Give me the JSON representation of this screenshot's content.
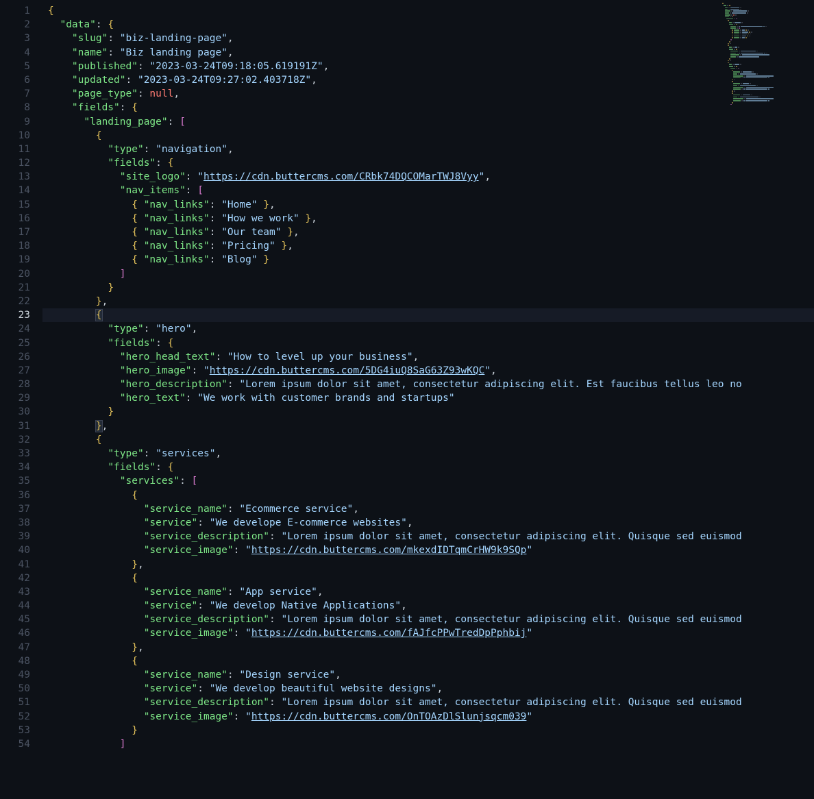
{
  "currentLine": 23,
  "colors": {
    "key": "#7ee787",
    "string": "#a5d6ff",
    "brace": "#e2c15a",
    "bracket": "#d97bd0",
    "null": "#ff7b72",
    "text": "#c9d1d9",
    "bg": "#0d1117"
  },
  "lines": [
    {
      "n": 1,
      "indent": 0,
      "tokens": [
        [
          "brace",
          "{"
        ]
      ]
    },
    {
      "n": 2,
      "indent": 1,
      "tokens": [
        [
          "key",
          "\"data\""
        ],
        [
          "punc",
          ": "
        ],
        [
          "brace",
          "{"
        ]
      ]
    },
    {
      "n": 3,
      "indent": 2,
      "tokens": [
        [
          "key",
          "\"slug\""
        ],
        [
          "punc",
          ": "
        ],
        [
          "str",
          "\"biz-landing-page\""
        ],
        [
          "punc",
          ","
        ]
      ]
    },
    {
      "n": 4,
      "indent": 2,
      "tokens": [
        [
          "key",
          "\"name\""
        ],
        [
          "punc",
          ": "
        ],
        [
          "str",
          "\"Biz landing page\""
        ],
        [
          "punc",
          ","
        ]
      ]
    },
    {
      "n": 5,
      "indent": 2,
      "tokens": [
        [
          "key",
          "\"published\""
        ],
        [
          "punc",
          ": "
        ],
        [
          "str",
          "\"2023-03-24T09:18:05.619191Z\""
        ],
        [
          "punc",
          ","
        ]
      ]
    },
    {
      "n": 6,
      "indent": 2,
      "tokens": [
        [
          "key",
          "\"updated\""
        ],
        [
          "punc",
          ": "
        ],
        [
          "str",
          "\"2023-03-24T09:27:02.403718Z\""
        ],
        [
          "punc",
          ","
        ]
      ]
    },
    {
      "n": 7,
      "indent": 2,
      "tokens": [
        [
          "key",
          "\"page_type\""
        ],
        [
          "punc",
          ": "
        ],
        [
          "null",
          "null"
        ],
        [
          "punc",
          ","
        ]
      ]
    },
    {
      "n": 8,
      "indent": 2,
      "tokens": [
        [
          "key",
          "\"fields\""
        ],
        [
          "punc",
          ": "
        ],
        [
          "brace",
          "{"
        ]
      ]
    },
    {
      "n": 9,
      "indent": 3,
      "tokens": [
        [
          "key",
          "\"landing_page\""
        ],
        [
          "punc",
          ": "
        ],
        [
          "bracket",
          "["
        ]
      ]
    },
    {
      "n": 10,
      "indent": 4,
      "tokens": [
        [
          "brace",
          "{"
        ]
      ]
    },
    {
      "n": 11,
      "indent": 5,
      "tokens": [
        [
          "key",
          "\"type\""
        ],
        [
          "punc",
          ": "
        ],
        [
          "str",
          "\"navigation\""
        ],
        [
          "punc",
          ","
        ]
      ]
    },
    {
      "n": 12,
      "indent": 5,
      "tokens": [
        [
          "key",
          "\"fields\""
        ],
        [
          "punc",
          ": "
        ],
        [
          "brace",
          "{"
        ]
      ]
    },
    {
      "n": 13,
      "indent": 6,
      "tokens": [
        [
          "key",
          "\"site_logo\""
        ],
        [
          "punc",
          ": "
        ],
        [
          "str",
          "\""
        ],
        [
          "link",
          "https://cdn.buttercms.com/CRbk74DQCOMarTWJ8Vyy"
        ],
        [
          "str",
          "\""
        ],
        [
          "punc",
          ","
        ]
      ]
    },
    {
      "n": 14,
      "indent": 6,
      "tokens": [
        [
          "key",
          "\"nav_items\""
        ],
        [
          "punc",
          ": "
        ],
        [
          "bracket",
          "["
        ]
      ]
    },
    {
      "n": 15,
      "indent": 7,
      "tokens": [
        [
          "brace",
          "{ "
        ],
        [
          "key",
          "\"nav_links\""
        ],
        [
          "punc",
          ": "
        ],
        [
          "str",
          "\"Home\""
        ],
        [
          "brace",
          " }"
        ],
        [
          "punc",
          ","
        ]
      ]
    },
    {
      "n": 16,
      "indent": 7,
      "tokens": [
        [
          "brace",
          "{ "
        ],
        [
          "key",
          "\"nav_links\""
        ],
        [
          "punc",
          ": "
        ],
        [
          "str",
          "\"How we work\""
        ],
        [
          "brace",
          " }"
        ],
        [
          "punc",
          ","
        ]
      ]
    },
    {
      "n": 17,
      "indent": 7,
      "tokens": [
        [
          "brace",
          "{ "
        ],
        [
          "key",
          "\"nav_links\""
        ],
        [
          "punc",
          ": "
        ],
        [
          "str",
          "\"Our team\""
        ],
        [
          "brace",
          " }"
        ],
        [
          "punc",
          ","
        ]
      ]
    },
    {
      "n": 18,
      "indent": 7,
      "tokens": [
        [
          "brace",
          "{ "
        ],
        [
          "key",
          "\"nav_links\""
        ],
        [
          "punc",
          ": "
        ],
        [
          "str",
          "\"Pricing\""
        ],
        [
          "brace",
          " }"
        ],
        [
          "punc",
          ","
        ]
      ]
    },
    {
      "n": 19,
      "indent": 7,
      "tokens": [
        [
          "brace",
          "{ "
        ],
        [
          "key",
          "\"nav_links\""
        ],
        [
          "punc",
          ": "
        ],
        [
          "str",
          "\"Blog\""
        ],
        [
          "brace",
          " }"
        ]
      ]
    },
    {
      "n": 20,
      "indent": 6,
      "tokens": [
        [
          "bracket",
          "]"
        ]
      ]
    },
    {
      "n": 21,
      "indent": 5,
      "tokens": [
        [
          "brace",
          "}"
        ]
      ]
    },
    {
      "n": 22,
      "indent": 4,
      "tokens": [
        [
          "brace",
          "}"
        ],
        [
          "punc",
          ","
        ]
      ]
    },
    {
      "n": 23,
      "indent": 4,
      "hl": true,
      "tokens": [
        [
          "cbrace",
          "{"
        ]
      ]
    },
    {
      "n": 24,
      "indent": 5,
      "tokens": [
        [
          "key",
          "\"type\""
        ],
        [
          "punc",
          ": "
        ],
        [
          "str",
          "\"hero\""
        ],
        [
          "punc",
          ","
        ]
      ]
    },
    {
      "n": 25,
      "indent": 5,
      "tokens": [
        [
          "key",
          "\"fields\""
        ],
        [
          "punc",
          ": "
        ],
        [
          "brace",
          "{"
        ]
      ]
    },
    {
      "n": 26,
      "indent": 6,
      "tokens": [
        [
          "key",
          "\"hero_head_text\""
        ],
        [
          "punc",
          ": "
        ],
        [
          "str",
          "\"How to level up your business\""
        ],
        [
          "punc",
          ","
        ]
      ]
    },
    {
      "n": 27,
      "indent": 6,
      "tokens": [
        [
          "key",
          "\"hero_image\""
        ],
        [
          "punc",
          ": "
        ],
        [
          "str",
          "\""
        ],
        [
          "link",
          "https://cdn.buttercms.com/5DG4iuQ8SaG63Z93wKQC"
        ],
        [
          "str",
          "\""
        ],
        [
          "punc",
          ","
        ]
      ]
    },
    {
      "n": 28,
      "indent": 6,
      "tokens": [
        [
          "key",
          "\"hero_description\""
        ],
        [
          "punc",
          ": "
        ],
        [
          "str",
          "\"Lorem ipsum dolor sit amet, consectetur adipiscing elit. Est faucibus tellus leo no"
        ]
      ]
    },
    {
      "n": 29,
      "indent": 6,
      "tokens": [
        [
          "key",
          "\"hero_text\""
        ],
        [
          "punc",
          ": "
        ],
        [
          "str",
          "\"We work with customer brands and startups\""
        ]
      ]
    },
    {
      "n": 30,
      "indent": 5,
      "tokens": [
        [
          "brace",
          "}"
        ]
      ]
    },
    {
      "n": 31,
      "indent": 4,
      "tokens": [
        [
          "cbrace",
          "}"
        ],
        [
          "punc",
          ","
        ]
      ]
    },
    {
      "n": 32,
      "indent": 4,
      "tokens": [
        [
          "brace",
          "{"
        ]
      ]
    },
    {
      "n": 33,
      "indent": 5,
      "tokens": [
        [
          "key",
          "\"type\""
        ],
        [
          "punc",
          ": "
        ],
        [
          "str",
          "\"services\""
        ],
        [
          "punc",
          ","
        ]
      ]
    },
    {
      "n": 34,
      "indent": 5,
      "tokens": [
        [
          "key",
          "\"fields\""
        ],
        [
          "punc",
          ": "
        ],
        [
          "brace",
          "{"
        ]
      ]
    },
    {
      "n": 35,
      "indent": 6,
      "tokens": [
        [
          "key",
          "\"services\""
        ],
        [
          "punc",
          ": "
        ],
        [
          "bracket",
          "["
        ]
      ]
    },
    {
      "n": 36,
      "indent": 7,
      "tokens": [
        [
          "brace",
          "{"
        ]
      ]
    },
    {
      "n": 37,
      "indent": 8,
      "tokens": [
        [
          "key",
          "\"service_name\""
        ],
        [
          "punc",
          ": "
        ],
        [
          "str",
          "\"Ecommerce service\""
        ],
        [
          "punc",
          ","
        ]
      ]
    },
    {
      "n": 38,
      "indent": 8,
      "tokens": [
        [
          "key",
          "\"service\""
        ],
        [
          "punc",
          ": "
        ],
        [
          "str",
          "\"We develope E-commerce websites\""
        ],
        [
          "punc",
          ","
        ]
      ]
    },
    {
      "n": 39,
      "indent": 8,
      "tokens": [
        [
          "key",
          "\"service_description\""
        ],
        [
          "punc",
          ": "
        ],
        [
          "str",
          "\"Lorem ipsum dolor sit amet, consectetur adipiscing elit. Quisque sed euismod"
        ]
      ]
    },
    {
      "n": 40,
      "indent": 8,
      "tokens": [
        [
          "key",
          "\"service_image\""
        ],
        [
          "punc",
          ": "
        ],
        [
          "str",
          "\""
        ],
        [
          "link",
          "https://cdn.buttercms.com/mkexdIDTqmCrHW9k9SQp"
        ],
        [
          "str",
          "\""
        ]
      ]
    },
    {
      "n": 41,
      "indent": 7,
      "tokens": [
        [
          "brace",
          "}"
        ],
        [
          "punc",
          ","
        ]
      ]
    },
    {
      "n": 42,
      "indent": 7,
      "tokens": [
        [
          "brace",
          "{"
        ]
      ]
    },
    {
      "n": 43,
      "indent": 8,
      "tokens": [
        [
          "key",
          "\"service_name\""
        ],
        [
          "punc",
          ": "
        ],
        [
          "str",
          "\"App service\""
        ],
        [
          "punc",
          ","
        ]
      ]
    },
    {
      "n": 44,
      "indent": 8,
      "tokens": [
        [
          "key",
          "\"service\""
        ],
        [
          "punc",
          ": "
        ],
        [
          "str",
          "\"We develop Native Applications\""
        ],
        [
          "punc",
          ","
        ]
      ]
    },
    {
      "n": 45,
      "indent": 8,
      "tokens": [
        [
          "key",
          "\"service_description\""
        ],
        [
          "punc",
          ": "
        ],
        [
          "str",
          "\"Lorem ipsum dolor sit amet, consectetur adipiscing elit. Quisque sed euismod"
        ]
      ]
    },
    {
      "n": 46,
      "indent": 8,
      "tokens": [
        [
          "key",
          "\"service_image\""
        ],
        [
          "punc",
          ": "
        ],
        [
          "str",
          "\""
        ],
        [
          "link",
          "https://cdn.buttercms.com/fAJfcPPwTredDpPphbij"
        ],
        [
          "str",
          "\""
        ]
      ]
    },
    {
      "n": 47,
      "indent": 7,
      "tokens": [
        [
          "brace",
          "}"
        ],
        [
          "punc",
          ","
        ]
      ]
    },
    {
      "n": 48,
      "indent": 7,
      "tokens": [
        [
          "brace",
          "{"
        ]
      ]
    },
    {
      "n": 49,
      "indent": 8,
      "tokens": [
        [
          "key",
          "\"service_name\""
        ],
        [
          "punc",
          ": "
        ],
        [
          "str",
          "\"Design service\""
        ],
        [
          "punc",
          ","
        ]
      ]
    },
    {
      "n": 50,
      "indent": 8,
      "tokens": [
        [
          "key",
          "\"service\""
        ],
        [
          "punc",
          ": "
        ],
        [
          "str",
          "\"We develop beautiful website designs\""
        ],
        [
          "punc",
          ","
        ]
      ]
    },
    {
      "n": 51,
      "indent": 8,
      "tokens": [
        [
          "key",
          "\"service_description\""
        ],
        [
          "punc",
          ": "
        ],
        [
          "str",
          "\"Lorem ipsum dolor sit amet, consectetur adipiscing elit. Quisque sed euismod"
        ]
      ]
    },
    {
      "n": 52,
      "indent": 8,
      "tokens": [
        [
          "key",
          "\"service_image\""
        ],
        [
          "punc",
          ": "
        ],
        [
          "str",
          "\""
        ],
        [
          "link",
          "https://cdn.buttercms.com/OnTOAzDlSlunjsqcm039"
        ],
        [
          "str",
          "\""
        ]
      ]
    },
    {
      "n": 53,
      "indent": 7,
      "tokens": [
        [
          "brace",
          "}"
        ]
      ]
    },
    {
      "n": 54,
      "indent": 6,
      "tokens": [
        [
          "bracket",
          "]"
        ]
      ]
    }
  ]
}
